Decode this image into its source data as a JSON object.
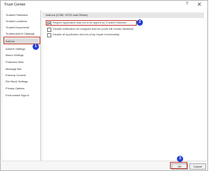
{
  "window": {
    "title": "Trust Center",
    "help_glyph": "?",
    "close_glyph": "✕"
  },
  "sidebar": {
    "items": [
      {
        "label": "Trusted Publishers",
        "active": false
      },
      {
        "label": "Trusted Locations",
        "active": false
      },
      {
        "label": "Trusted Documents",
        "active": false
      },
      {
        "label": "Trusted Add-in Catalogs",
        "active": false
      },
      {
        "label": "Add-ins",
        "active": true
      },
      {
        "label": "ActiveX Settings",
        "active": false
      },
      {
        "label": "Macro Settings",
        "active": false
      },
      {
        "label": "Protected View",
        "active": false
      },
      {
        "label": "Message Bar",
        "active": false
      },
      {
        "label": "External Content",
        "active": false
      },
      {
        "label": "File Block Settings",
        "active": false
      },
      {
        "label": "Privacy Options",
        "active": false
      },
      {
        "label": "Form-based Sign-in",
        "active": false
      }
    ]
  },
  "main": {
    "section_title": "Add-ins (COM, VSTO and Others)",
    "options": [
      {
        "label": "Require Application Add-ins to be signed by Trusted Publisher",
        "checked": true
      },
      {
        "label": "Disable notification for unsigned add-ins (code will remain disabled)",
        "checked": false
      },
      {
        "label": "Disable all Application Add-ins (may impair functionality)",
        "checked": false
      }
    ]
  },
  "footer": {
    "ok_label": "OK",
    "cancel_label": "Cancel"
  },
  "annotations": {
    "badge1": "1",
    "badge2": "2",
    "badge3": "3",
    "highlight_color": "#c0392b",
    "badge_color": "#1f3bd6"
  }
}
